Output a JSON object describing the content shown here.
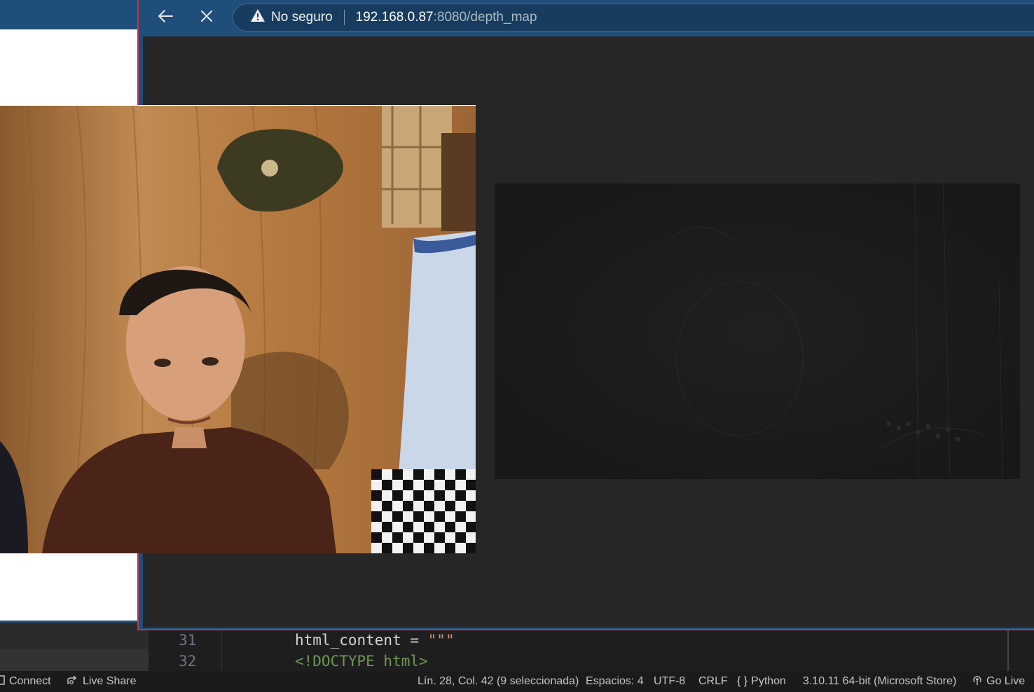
{
  "browser": {
    "back_icon": "arrow-left-icon",
    "stop_icon": "close-icon",
    "security_icon": "warning-icon",
    "security_label": "No seguro",
    "url_host": "192.168.0.87",
    "url_rest": ":8080/depth_map"
  },
  "editor": {
    "lines": [
      {
        "number": "31",
        "code": "html_content = ",
        "string": "\"\"\""
      },
      {
        "number": "32",
        "code": "<!DOCTYPE html>"
      }
    ]
  },
  "statusbar": {
    "connect": "Connect",
    "live_share": "Live Share",
    "position": "Lín. 28, Col. 42 (9 seleccionada)",
    "spaces": "Espacios: 4",
    "encoding": "UTF-8",
    "eol": "CRLF",
    "language_icon": "{ }",
    "language": "Python",
    "interpreter": "3.10.11 64-bit (Microsoft Store)",
    "go_live": "Go Live"
  },
  "colors": {
    "browser_frame": "#1f4e7a",
    "page_background": "#262626",
    "accent_border": "#b33a4e"
  }
}
